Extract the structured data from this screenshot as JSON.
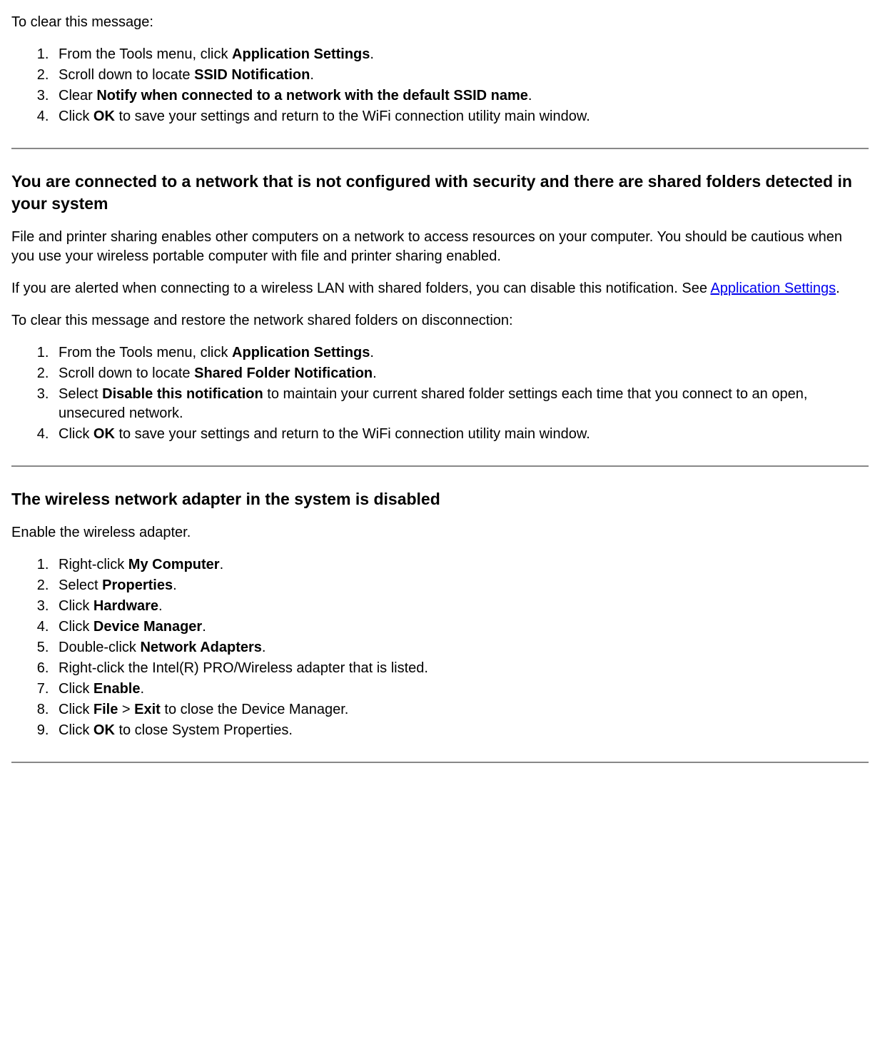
{
  "section1": {
    "intro": "To clear this message:",
    "step1_pre": "From the Tools menu, click ",
    "step1_bold": "Application Settings",
    "step1_post": ".",
    "step2_pre": "Scroll down to locate ",
    "step2_bold": "SSID Notification",
    "step2_post": ".",
    "step3_pre": "Clear ",
    "step3_bold": "Notify when connected to a network with the default SSID name",
    "step3_post": ".",
    "step4_pre": "Click ",
    "step4_bold": "OK",
    "step4_post": " to save your settings and return to the WiFi connection utility main window."
  },
  "section2": {
    "heading": "You are connected to a network that is not configured with security and there are shared folders detected in your system",
    "para1": "File and printer sharing enables other computers on a network to access resources on your computer. You should be cautious when you use your wireless portable computer with file and printer sharing enabled.",
    "para2_pre": "If you are alerted when connecting to a wireless LAN with shared folders, you can disable this notification. See ",
    "para2_link": "Application Settings",
    "para2_post": ".",
    "para3": "To clear this message and restore the network shared folders on disconnection:",
    "step1_pre": "From the Tools menu, click ",
    "step1_bold": "Application Settings",
    "step1_post": ".",
    "step2_pre": "Scroll down to locate ",
    "step2_bold": "Shared Folder Notification",
    "step2_post": ".",
    "step3_pre": "Select ",
    "step3_bold": "Disable this notification",
    "step3_post": " to maintain your current shared folder settings each time that you connect to an open, unsecured network.",
    "step4_pre": "Click ",
    "step4_bold": "OK",
    "step4_post": " to save your settings and return to the WiFi connection utility main window."
  },
  "section3": {
    "heading": "The wireless network adapter in the system is disabled",
    "para1": "Enable the wireless adapter.",
    "step1_pre": "Right-click ",
    "step1_bold": "My Computer",
    "step1_post": ".",
    "step2_pre": "Select ",
    "step2_bold": "Properties",
    "step2_post": ".",
    "step3_pre": "Click ",
    "step3_bold": "Hardware",
    "step3_post": ".",
    "step4_pre": "Click ",
    "step4_bold": "Device Manager",
    "step4_post": ".",
    "step5_pre": "Double-click ",
    "step5_bold": "Network Adapters",
    "step5_post": ".",
    "step6": "Right-click the Intel(R) PRO/Wireless adapter that is listed.",
    "step7_pre": "Click ",
    "step7_bold": "Enable",
    "step7_post": ".",
    "step8_pre": "Click ",
    "step8_bold1": "File",
    "step8_mid": " > ",
    "step8_bold2": "Exit",
    "step8_post": " to close the Device Manager.",
    "step9_pre": "Click ",
    "step9_bold": "OK",
    "step9_post": " to close System Properties."
  }
}
